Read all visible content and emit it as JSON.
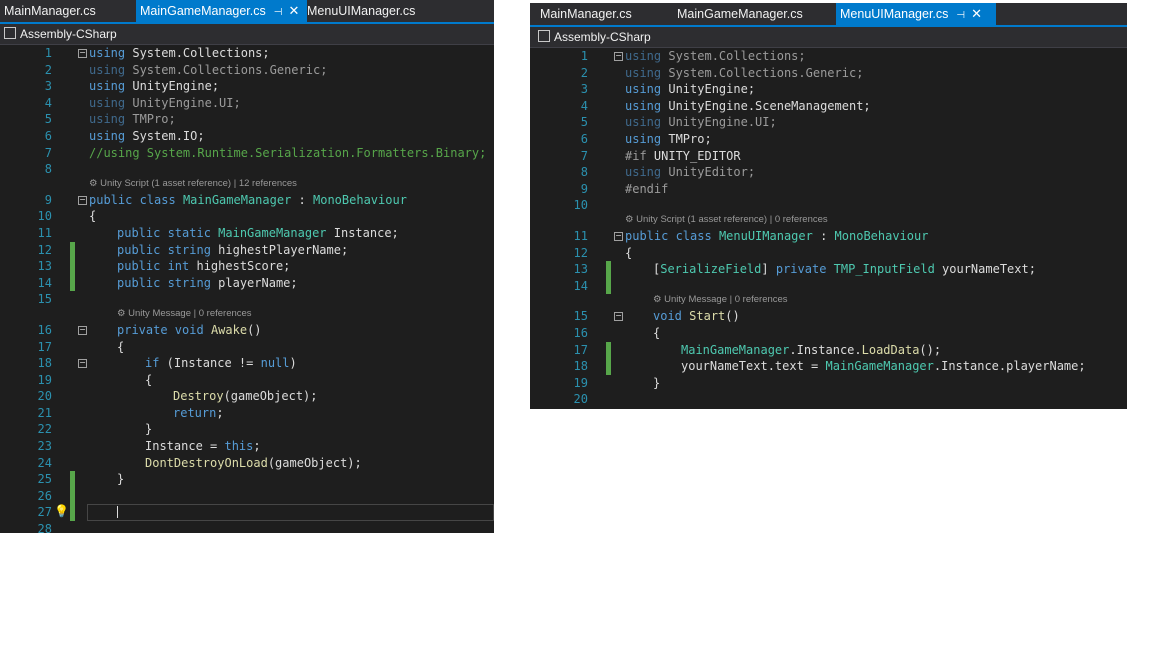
{
  "left": {
    "tabs": [
      {
        "label": "MainManager.cs"
      },
      {
        "label": "MainGameManager.cs"
      },
      {
        "label": "MenuUIManager.cs"
      }
    ],
    "pin_glyph": "⊣",
    "close_glyph": "✕",
    "project": "Assembly-CSharp",
    "lens_class": "Unity Script (1 asset reference) | 12 references",
    "lens_awake": "Unity Message | 0 references",
    "line_numbers": [
      "1",
      "2",
      "3",
      "4",
      "5",
      "6",
      "7",
      "8",
      "9",
      "10",
      "11",
      "12",
      "13",
      "14",
      "15",
      "16",
      "17",
      "18",
      "19",
      "20",
      "21",
      "22",
      "23",
      "24",
      "25",
      "26",
      "27",
      "28"
    ],
    "code": {
      "l1_kw": "using",
      "l1_rest": " System.Collections;",
      "l2_kw": "using",
      "l2_rest": " System.Collections.Generic;",
      "l3_kw": "using",
      "l3_rest": " UnityEngine;",
      "l4_kw": "using",
      "l4_rest": " UnityEngine.UI;",
      "l5_kw": "using",
      "l5_rest": " TMPro;",
      "l6_kw": "using",
      "l6_rest": " System.IO;",
      "l7": "//using System.Runtime.Serialization.Formatters.Binary;",
      "l9_kw": "public class",
      "l9_ty": "MainGameManager",
      "l9_sep": " : ",
      "l9_base": "MonoBehaviour",
      "l10": "{",
      "l11_kw": "public static",
      "l11_ty": "MainGameManager",
      "l11_rest": " Instance;",
      "l12_kw": "public string",
      "l12_rest": " highestPlayerName;",
      "l13_kw": "public int",
      "l13_rest": " highestScore;",
      "l14_kw": "public string",
      "l14_rest": " playerName;",
      "l16_kw": "private void",
      "l16_fn": "Awake",
      "l16_rest": "()",
      "l17": "{",
      "l18_kw": "if",
      "l18_rest": " (Instance != ",
      "l18_null": "null",
      "l18_end": ")",
      "l19": "{",
      "l20_fn": "Destroy",
      "l20_rest": "(gameObject);",
      "l21_kw": "return",
      "l21_rest": ";",
      "l22": "}",
      "l23_rest": "Instance = ",
      "l23_kw": "this",
      "l23_end": ";",
      "l24_fn": "DontDestroyOnLoad",
      "l24_rest": "(gameObject);",
      "l25": "}"
    }
  },
  "right": {
    "tabs": [
      {
        "label": "MainManager.cs"
      },
      {
        "label": "MainGameManager.cs"
      },
      {
        "label": "MenuUIManager.cs"
      }
    ],
    "pin_glyph": "⊣",
    "close_glyph": "✕",
    "project": "Assembly-CSharp",
    "lens_class": "Unity Script (1 asset reference) | 0 references",
    "lens_start": "Unity Message | 0 references",
    "line_numbers": [
      "1",
      "2",
      "3",
      "4",
      "5",
      "6",
      "7",
      "8",
      "9",
      "10",
      "11",
      "12",
      "13",
      "14",
      "15",
      "16",
      "17",
      "18",
      "19",
      "20"
    ],
    "code": {
      "l1_kw": "using",
      "l1_rest": " System.Collections;",
      "l2_kw": "using",
      "l2_rest": " System.Collections.Generic;",
      "l3_kw": "using",
      "l3_rest": " UnityEngine;",
      "l4_kw": "using",
      "l4_rest": " UnityEngine.SceneManagement;",
      "l5_kw": "using",
      "l5_rest": " UnityEngine.UI;",
      "l6_kw": "using",
      "l6_rest": " TMPro;",
      "l7_pp": "#if",
      "l7_rest": " UNITY_EDITOR",
      "l8_kw": "using",
      "l8_rest": " UnityEditor;",
      "l9_pp": "#endif",
      "l11_kw": "public class",
      "l11_ty": "MenuUIManager",
      "l11_sep": " : ",
      "l11_base": "MonoBehaviour",
      "l12": "{",
      "l13_open": "[",
      "l13_attr": "SerializeField",
      "l13_close": "] ",
      "l13_kw": "private",
      "l13_sp": " ",
      "l13_ty": "TMP_InputField",
      "l13_rest": " yourNameText;",
      "l15_kw": "void",
      "l15_fn": "Start",
      "l15_rest": "()",
      "l16": "{",
      "l17_ty": "MainGameManager",
      "l17_mid": ".Instance.",
      "l17_fn": "LoadData",
      "l17_rest": "();",
      "l18_rest": "yourNameText.text = ",
      "l18_ty": "MainGameManager",
      "l18_end": ".Instance.playerName;",
      "l19": "}"
    }
  },
  "colors": {
    "background": "#1e1e1e",
    "keyword": "#569cd6",
    "type": "#4ec9b0",
    "method": "#dcdcaa",
    "comment": "#57a64a",
    "line_number": "#2b91af",
    "accent": "#007acc"
  },
  "icons": [
    "pin-icon",
    "close-icon",
    "project-icon",
    "unity-icon",
    "lightbulb-icon",
    "collapse-icon"
  ]
}
